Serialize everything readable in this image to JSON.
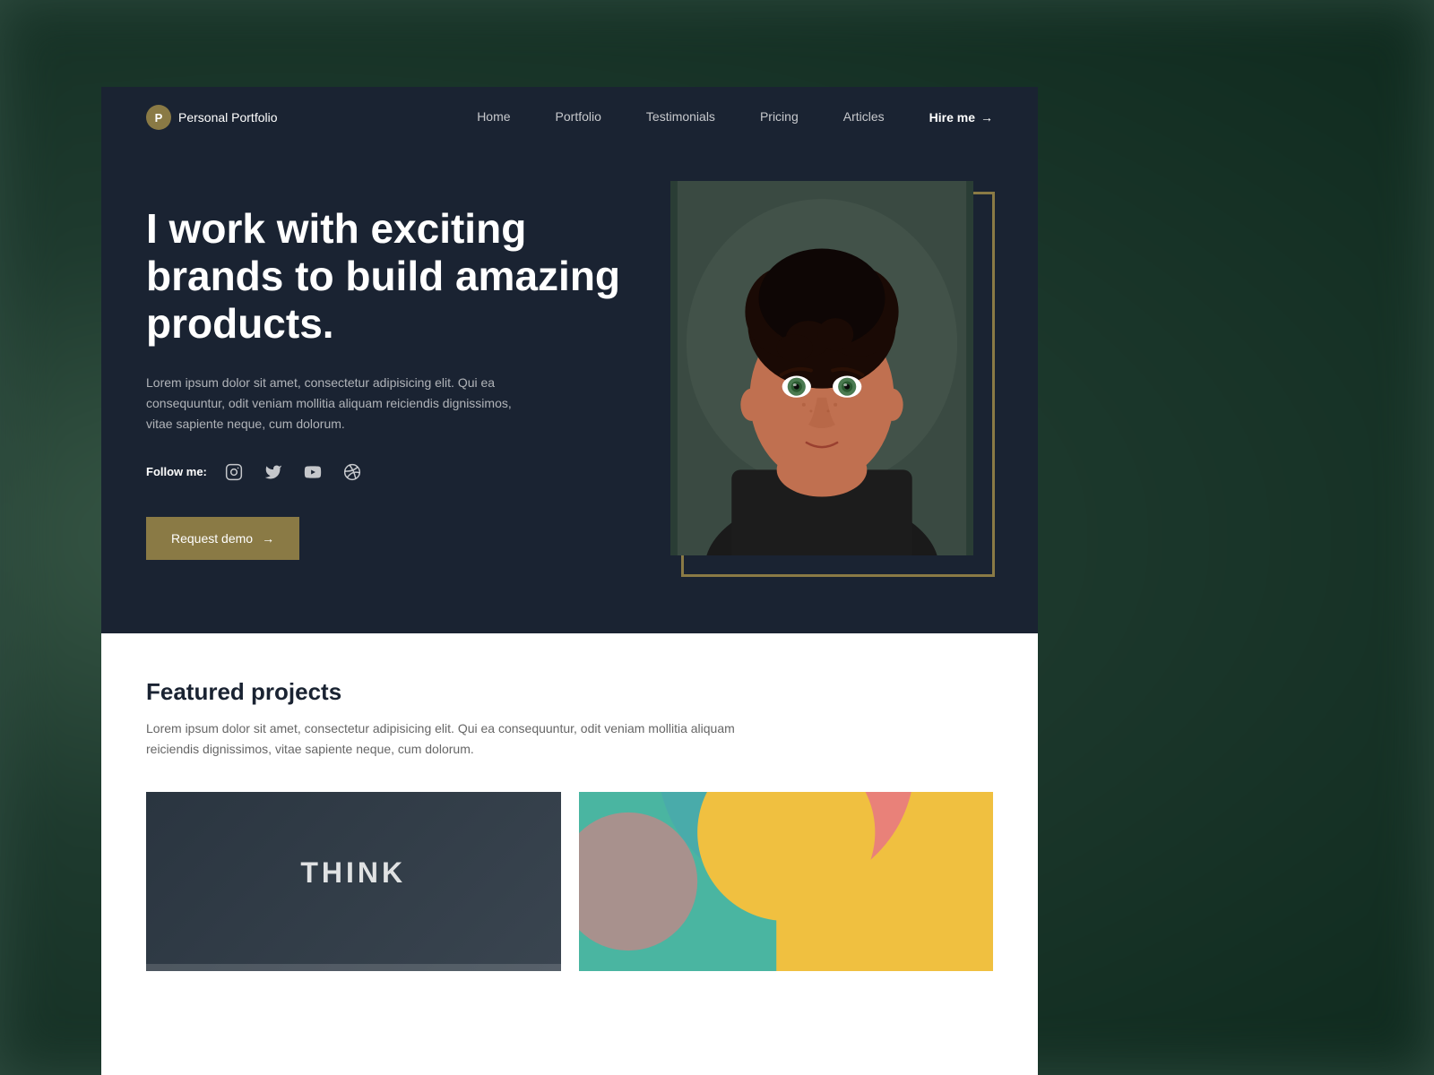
{
  "background": {
    "color": "#2d4a3e"
  },
  "navbar": {
    "logo_letter": "P",
    "logo_text": "Personal Portfolio",
    "links": [
      {
        "label": "Home",
        "href": "#"
      },
      {
        "label": "Portfolio",
        "href": "#"
      },
      {
        "label": "Testimonials",
        "href": "#"
      },
      {
        "label": "Pricing",
        "href": "#"
      },
      {
        "label": "Articles",
        "href": "#"
      }
    ],
    "hire_label": "Hire me",
    "hire_arrow": "→"
  },
  "hero": {
    "heading": "I work with exciting brands to build amazing products.",
    "description": "Lorem ipsum dolor sit amet, consectetur adipisicing elit. Qui ea consequuntur, odit veniam mollitia aliquam reiciendis dignissimos, vitae sapiente neque, cum dolorum.",
    "follow_label": "Follow me:",
    "social_icons": [
      "instagram",
      "twitter",
      "youtube",
      "dribbble"
    ],
    "cta_label": "Request demo",
    "cta_arrow": "→"
  },
  "featured": {
    "title": "Featured projects",
    "description": "Lorem ipsum dolor sit amet, consectetur adipisicing elit. Qui ea consequuntur, odit veniam mollitia aliquam reiciendis dignissimos, vitae sapiente neque, cum dolorum.",
    "projects": [
      {
        "type": "think",
        "text": "THINK"
      },
      {
        "type": "colorful"
      }
    ]
  },
  "colors": {
    "accent": "#8a7a45",
    "dark_bg": "#1a2332",
    "white": "#ffffff"
  }
}
